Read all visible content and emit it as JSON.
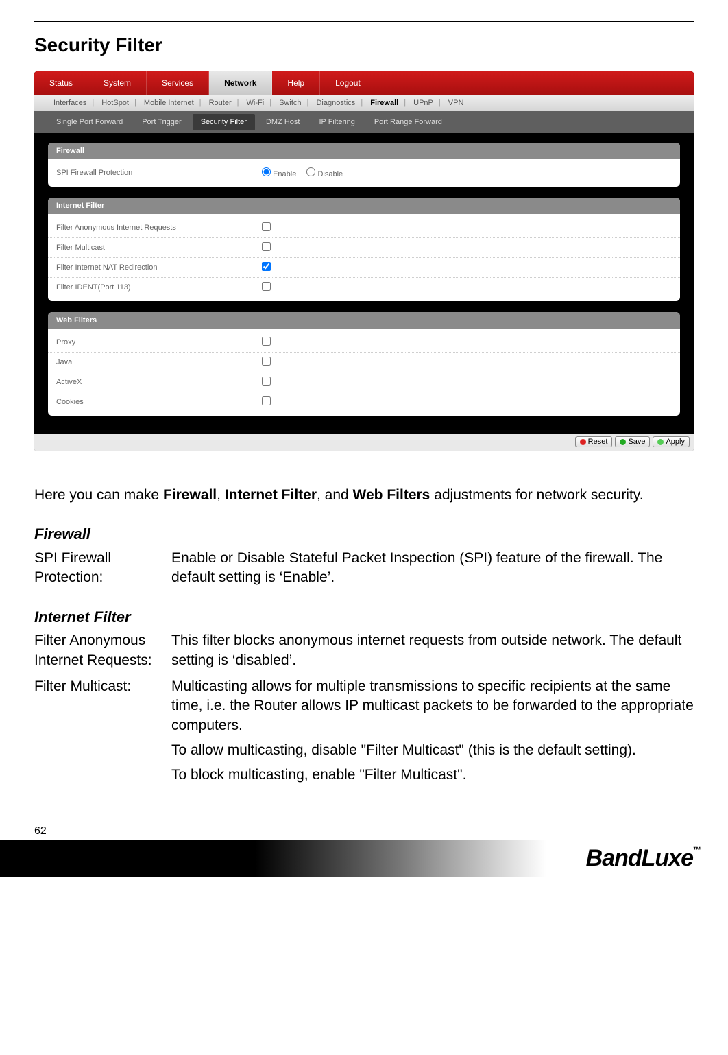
{
  "page_title": "Security Filter",
  "page_number": "62",
  "brand_text": "BandLuxe",
  "brand_tm": "™",
  "main_tabs": {
    "status": "Status",
    "system": "System",
    "services": "Services",
    "network": "Network",
    "help": "Help",
    "logout": "Logout"
  },
  "sub_nav": {
    "interfaces": "Interfaces",
    "hotspot": "HotSpot",
    "mobile_internet": "Mobile Internet",
    "router": "Router",
    "wifi": "Wi-Fi",
    "switch": "Switch",
    "diagnostics": "Diagnostics",
    "firewall": "Firewall",
    "upnp": "UPnP",
    "vpn": "VPN"
  },
  "third_nav": {
    "single_port_forward": "Single Port Forward",
    "port_trigger": "Port Trigger",
    "security_filter": "Security Filter",
    "dmz_host": "DMZ Host",
    "ip_filtering": "IP Filtering",
    "port_range_forward": "Port Range Forward"
  },
  "panels": {
    "firewall": {
      "title": "Firewall",
      "spi_label": "SPI Firewall Protection",
      "enable": "Enable",
      "disable": "Disable"
    },
    "internet_filter": {
      "title": "Internet Filter",
      "rows": {
        "anon": "Filter Anonymous Internet Requests",
        "multicast": "Filter Multicast",
        "nat": "Filter Internet NAT Redirection",
        "ident": "Filter IDENT(Port 113)"
      },
      "checked": {
        "anon": false,
        "multicast": false,
        "nat": true,
        "ident": false
      }
    },
    "web_filters": {
      "title": "Web Filters",
      "rows": {
        "proxy": "Proxy",
        "java": "Java",
        "activex": "ActiveX",
        "cookies": "Cookies"
      }
    }
  },
  "buttons": {
    "reset": "Reset",
    "save": "Save",
    "apply": "Apply"
  },
  "doc": {
    "intro_pre": "Here you can make ",
    "intro_b1": "Firewall",
    "intro_sep1": ", ",
    "intro_b2": "Internet Filter",
    "intro_sep2": ", and ",
    "intro_b3": "Web Filters",
    "intro_post": " adjustments for network security.",
    "firewall_title": "Firewall",
    "spi_term": "SPI Firewall Protection:",
    "spi_def": "Enable or Disable Stateful Packet Inspection (SPI) feature of the firewall. The default setting is ‘Enable’.",
    "internet_filter_title": "Internet Filter",
    "anon_term": "Filter Anonymous Internet Requests:",
    "anon_def": "This filter blocks anonymous internet requests from outside network. The default setting is ‘disabled’.",
    "multicast_term": "Filter Multicast:",
    "multicast_def1": "Multicasting allows for multiple transmissions to specific recipients at the same time, i.e. the Router allows IP multicast packets to be forwarded to the appropriate computers.",
    "multicast_def2": "To allow multicasting, disable \"Filter Multicast\" (this is the default setting).",
    "multicast_def3": "To block multicasting, enable \"Filter Multicast\"."
  }
}
